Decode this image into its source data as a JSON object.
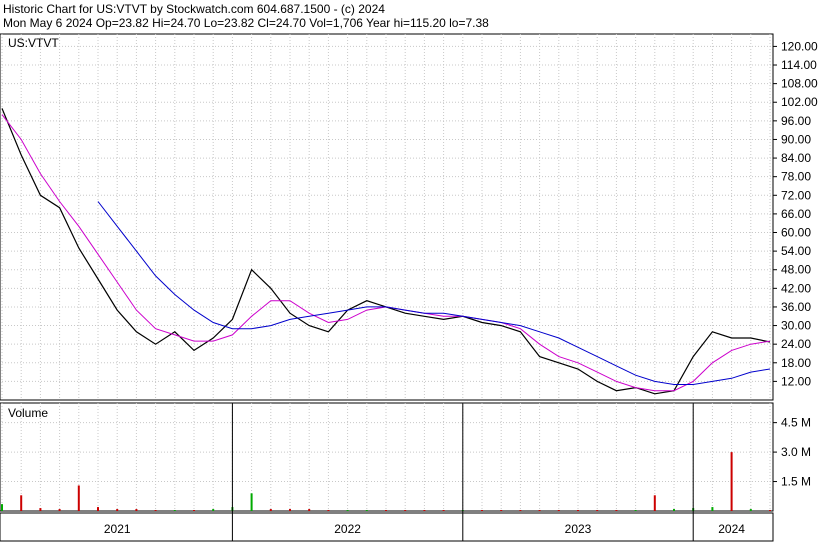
{
  "header": {
    "line1": "Historic Chart for US:VTVT by Stockwatch.com 604.687.1500 - (c) 2024",
    "line2": "Mon May  6 2024   Op=23.82  Hi=24.70  Lo=23.82  Cl=24.70  Vol=1,706  Year hi=115.20  lo=7.38"
  },
  "colors": {
    "price": "#000000",
    "ma_short": "#cc00cc",
    "ma_long": "#0000cc",
    "volume_up": "#00aa00",
    "volume_down": "#cc0000",
    "grid": "#c8c8c8",
    "frame": "#000000"
  },
  "chart_data": [
    {
      "type": "line",
      "title": "US:VTVT",
      "ylim": [
        6,
        124
      ],
      "y_ticks": [
        "120.00",
        "114.00",
        "108.00",
        "102.00",
        "96.00",
        "90.00",
        "84.00",
        "78.00",
        "72.00",
        "66.00",
        "60.00",
        "54.00",
        "48.00",
        "42.00",
        "36.00",
        "30.00",
        "24.00",
        "18.00",
        "12.00"
      ],
      "x_labels": [
        "2021",
        "2022",
        "2023",
        "2024"
      ],
      "x": [
        "2021-01",
        "2021-02",
        "2021-03",
        "2021-04",
        "2021-05",
        "2021-06",
        "2021-07",
        "2021-08",
        "2021-09",
        "2021-10",
        "2021-11",
        "2021-12",
        "2022-01",
        "2022-02",
        "2022-03",
        "2022-04",
        "2022-05",
        "2022-06",
        "2022-07",
        "2022-08",
        "2022-09",
        "2022-10",
        "2022-11",
        "2022-12",
        "2023-01",
        "2023-02",
        "2023-03",
        "2023-04",
        "2023-05",
        "2023-06",
        "2023-07",
        "2023-08",
        "2023-09",
        "2023-10",
        "2023-11",
        "2023-12",
        "2024-01",
        "2024-02",
        "2024-03",
        "2024-04",
        "2024-05"
      ],
      "series": [
        {
          "role": "price",
          "values": [
            100,
            85,
            72,
            68,
            55,
            45,
            35,
            28,
            24,
            28,
            22,
            26,
            32,
            48,
            42,
            34,
            30,
            28,
            35,
            38,
            36,
            34,
            33,
            32,
            33,
            31,
            30,
            28,
            20,
            18,
            16,
            12,
            9,
            10,
            8,
            9,
            20,
            28,
            26,
            26,
            24.7
          ]
        },
        {
          "role": "ma_short",
          "values": [
            98,
            90,
            79,
            70,
            62,
            53,
            44,
            35,
            29,
            27,
            25,
            25,
            27,
            33,
            38,
            38,
            34,
            31,
            32,
            35,
            36,
            35,
            34,
            33,
            33,
            32,
            31,
            29,
            24,
            20,
            18,
            15,
            12,
            10,
            9,
            9,
            12,
            18,
            22,
            24,
            25
          ]
        },
        {
          "role": "ma_long",
          "values": [
            null,
            null,
            null,
            null,
            null,
            70,
            62,
            54,
            46,
            40,
            35,
            31,
            29,
            29,
            30,
            32,
            33,
            34,
            35,
            36,
            36,
            35,
            34,
            34,
            33,
            32,
            31,
            30,
            28,
            26,
            23,
            20,
            17,
            14,
            12,
            11,
            11,
            12,
            13,
            15,
            16
          ]
        }
      ]
    },
    {
      "type": "bar",
      "title": "Volume",
      "ylim": [
        0,
        5.5
      ],
      "y_ticks": [
        "4.5 M",
        "3.0 M",
        "1.5 M"
      ],
      "x": [
        "2021-01",
        "2021-02",
        "2021-03",
        "2021-04",
        "2021-05",
        "2021-06",
        "2021-07",
        "2021-08",
        "2021-09",
        "2021-10",
        "2021-11",
        "2021-12",
        "2022-01",
        "2022-02",
        "2022-03",
        "2022-04",
        "2022-05",
        "2022-06",
        "2022-07",
        "2022-08",
        "2022-09",
        "2022-10",
        "2022-11",
        "2022-12",
        "2023-01",
        "2023-02",
        "2023-03",
        "2023-04",
        "2023-05",
        "2023-06",
        "2023-07",
        "2023-08",
        "2023-09",
        "2023-10",
        "2023-11",
        "2023-12",
        "2024-01",
        "2024-02",
        "2024-03",
        "2024-04",
        "2024-05"
      ],
      "values": [
        0.35,
        0.8,
        0.15,
        0.1,
        1.3,
        0.2,
        0.1,
        0.1,
        0.05,
        0.05,
        0.05,
        0.1,
        0.2,
        0.9,
        0.1,
        0.1,
        0.1,
        0.05,
        0.05,
        0.05,
        0.05,
        0.05,
        0.05,
        0.05,
        0.05,
        0.05,
        0.05,
        0.05,
        0.05,
        0.05,
        0.05,
        0.05,
        0.05,
        0.05,
        0.8,
        0.1,
        0.15,
        0.2,
        3.0,
        0.1,
        0.05
      ]
    }
  ]
}
